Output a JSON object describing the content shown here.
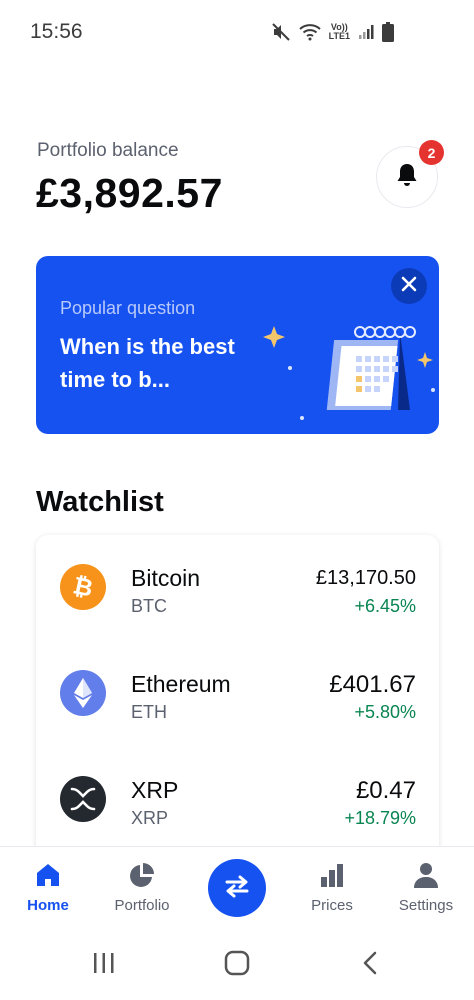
{
  "status_bar": {
    "time": "15:56",
    "icons": [
      "mute-icon",
      "wifi-icon",
      "volte-lte-icon",
      "signal-icon",
      "battery-icon"
    ],
    "lte_line1": "Vo))",
    "lte_line2": "LTE1"
  },
  "header": {
    "portfolio_label": "Portfolio balance",
    "portfolio_value": "£3,892.57",
    "notification_count": "2"
  },
  "promo": {
    "kicker": "Popular question",
    "title": "When is the best time to b...",
    "background": "#1652f0"
  },
  "watchlist": {
    "heading": "Watchlist",
    "assets": [
      {
        "name": "Bitcoin",
        "ticker": "BTC",
        "price": "£13,170.50",
        "change": "+6.45%",
        "color": "#f7931a",
        "icon": "bitcoin-icon"
      },
      {
        "name": "Ethereum",
        "ticker": "ETH",
        "price": "£401.67",
        "change": "+5.80%",
        "color": "#627eea",
        "icon": "ethereum-icon"
      },
      {
        "name": "XRP",
        "ticker": "XRP",
        "price": "£0.47",
        "change": "+18.79%",
        "color": "#23292f",
        "icon": "xrp-icon"
      }
    ]
  },
  "bottom_nav": {
    "items": [
      {
        "label": "Home",
        "icon": "home-icon",
        "active": true
      },
      {
        "label": "Portfolio",
        "icon": "pie-chart-icon",
        "active": false
      },
      {
        "label": "",
        "icon": "swap-arrows-icon",
        "active": false
      },
      {
        "label": "Prices",
        "icon": "bar-chart-icon",
        "active": false
      },
      {
        "label": "Settings",
        "icon": "user-icon",
        "active": false
      }
    ]
  },
  "colors": {
    "accent": "#1652f0",
    "positive": "#098551",
    "badge": "#e5342f"
  }
}
